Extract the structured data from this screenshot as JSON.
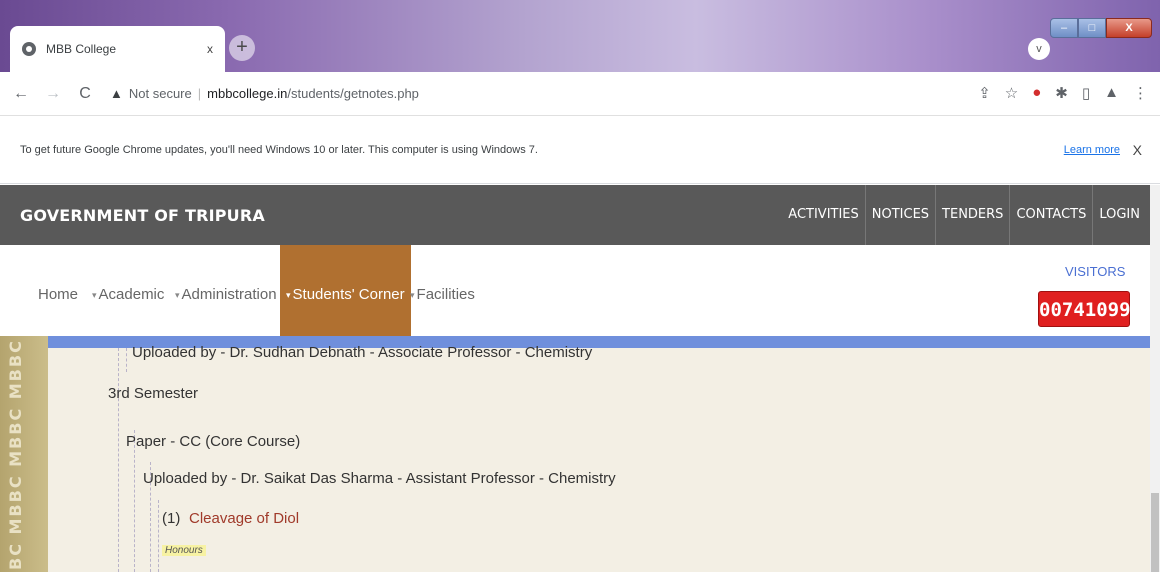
{
  "browser": {
    "tab_title": "MBB College",
    "tab_close": "x",
    "new_tab": "+",
    "tab_search": "v",
    "window_buttons": {
      "minimize": "–",
      "maximize": "□",
      "close": "X"
    },
    "nav": {
      "back": "←",
      "forward": "→",
      "reload": "C"
    },
    "address": {
      "warning_icon": "▲",
      "not_secure": "Not secure",
      "separator": "|",
      "host": "mbbcollege.in",
      "path": "/students/getnotes.php"
    },
    "toolbar_icons": [
      "share-icon",
      "star-icon",
      "extension-icon",
      "puzzle-icon",
      "sidepanel-icon",
      "profile-icon",
      "menu-icon"
    ],
    "toolbar_glyphs": {
      "share": "⇪",
      "star": "☆",
      "extension": "●",
      "puzzle": "✱",
      "sidepanel": "▯",
      "profile": "▲",
      "menu": "⋮"
    }
  },
  "infobar": {
    "message": "To get future Google Chrome updates, you'll need Windows 10 or later. This computer is using Windows 7.",
    "learn_more": "Learn more",
    "close": "X"
  },
  "site": {
    "title": "GOVERNMENT OF TRIPURA",
    "top_nav": [
      "ACTIVITIES",
      "NOTICES",
      "TENDERS",
      "CONTACTS",
      "LOGIN"
    ],
    "main_nav": {
      "bullet": "▾",
      "home": "Home",
      "academic": "Academic",
      "administration": "Administration",
      "students_corner": "Students' Corner",
      "facilities": "Facilities"
    },
    "visitors_label": "VISITORS",
    "visitors_count": "00741099",
    "side_band_text": "BC MBBC MBBC MBBC M"
  },
  "content": {
    "uploaded_1": "Uploaded by - Dr. Sudhan Debnath - Associate Professor - Chemistry",
    "semester": "3rd Semester",
    "paper": "Paper - CC (Core Course)",
    "uploaded_2": "Uploaded by - Dr. Saikat Das Sharma - Assistant Professor - Chemistry",
    "item_number": "(1)",
    "item_link": "Cleavage of Diol",
    "item_tag": "Honours"
  },
  "colors": {
    "gov_bar": "#595959",
    "active_nav": "#b07030",
    "blue_strip": "#6f8fdc",
    "visitor_badge": "#e02020",
    "link": "#a03a2a"
  }
}
